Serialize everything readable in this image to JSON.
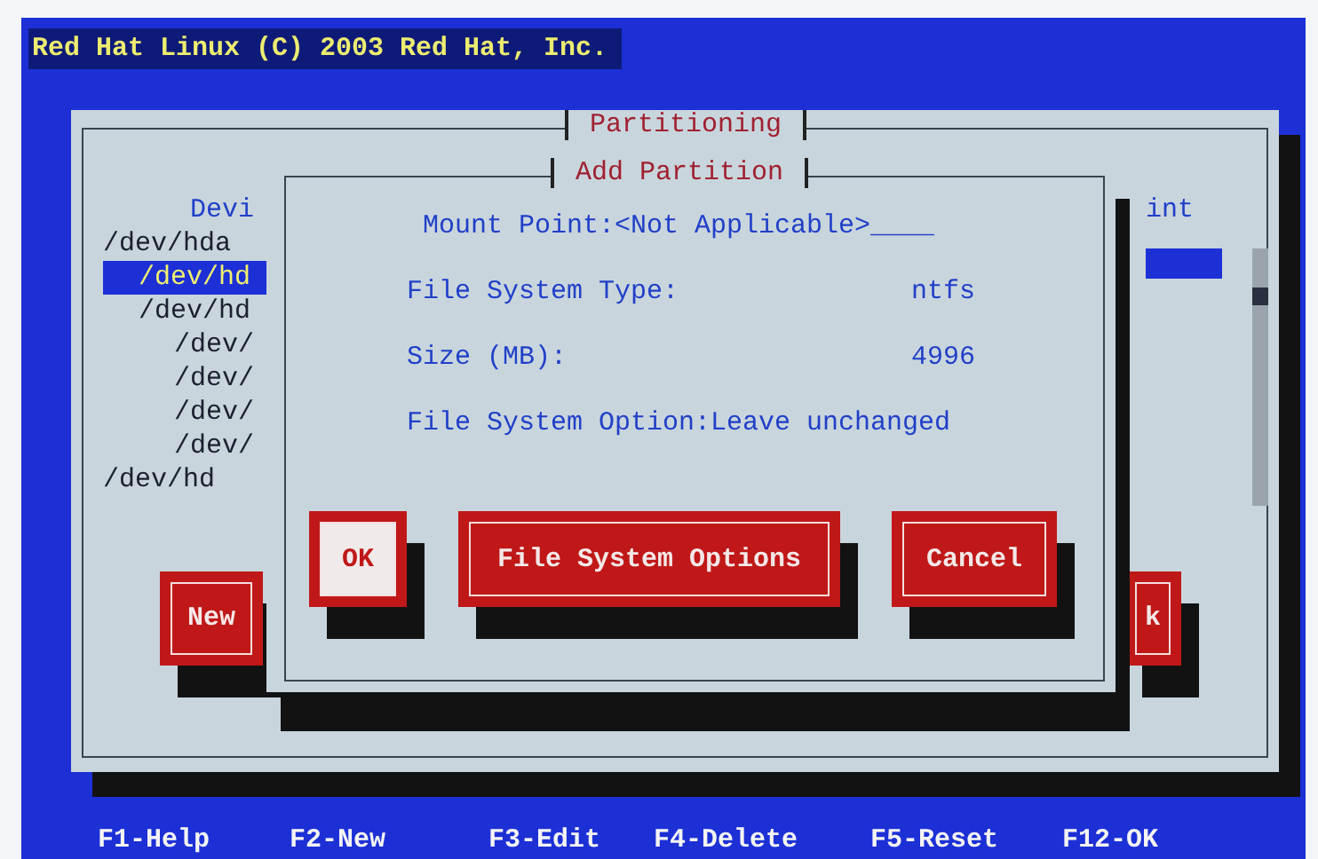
{
  "header": "Red Hat Linux (C) 2003 Red Hat, Inc.",
  "window": {
    "title": "Partitioning",
    "column_1": "Devi",
    "column_2": "int",
    "devices": [
      {
        "label": "/dev/hda",
        "selected": false,
        "children": [
          {
            "label": "/dev/hd",
            "selected": true
          },
          {
            "label": "/dev/hd",
            "selected": false,
            "children": [
              {
                "label": "/dev/",
                "selected": false
              },
              {
                "label": "/dev/",
                "selected": false
              },
              {
                "label": "/dev/",
                "selected": false
              },
              {
                "label": "/dev/",
                "selected": false
              }
            ]
          }
        ]
      },
      {
        "label": "/dev/hd",
        "selected": false
      }
    ],
    "buttons": [
      "New",
      "k"
    ]
  },
  "dialog": {
    "title": "Add Partition",
    "fields": [
      {
        "kind": "input",
        "label": "Mount Point:",
        "value": "<Not Applicable>____"
      },
      {
        "kind": "pair",
        "label": "File System Type:",
        "value": "ntfs"
      },
      {
        "kind": "pair",
        "label": "Size (MB):",
        "value": "4996"
      },
      {
        "kind": "inline",
        "label": "File System Option:",
        "value": "Leave unchanged"
      }
    ],
    "buttons": [
      {
        "label": "OK",
        "focused": true
      },
      {
        "label": "File System Options",
        "focused": false
      },
      {
        "label": "Cancel",
        "focused": false
      }
    ]
  },
  "footer": [
    "F1-Help",
    "F2-New",
    "F3-Edit",
    "F4-Delete",
    "F5-Reset",
    "F12-OK"
  ]
}
